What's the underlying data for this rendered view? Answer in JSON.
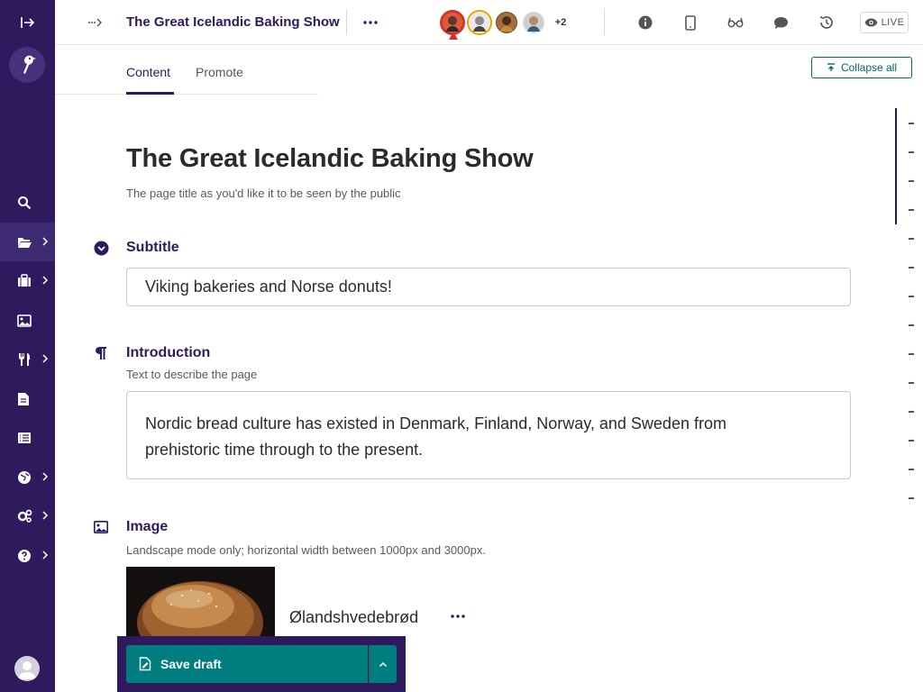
{
  "header": {
    "page_title": "The Great Icelandic Baking Show",
    "avatars_overflow": "+2",
    "live_label": "LIVE"
  },
  "tabs": [
    {
      "label": "Content",
      "active": true
    },
    {
      "label": "Promote",
      "active": false
    }
  ],
  "collapse_label": "Collapse all",
  "sidebar": {
    "items": [
      {
        "icon": "search-icon",
        "has_submenu": false
      },
      {
        "icon": "folder-open-icon",
        "has_submenu": true,
        "active": true
      },
      {
        "icon": "suitcase-icon",
        "has_submenu": true
      },
      {
        "icon": "image-icon",
        "has_submenu": false
      },
      {
        "icon": "utensils-icon",
        "has_submenu": true
      },
      {
        "icon": "document-icon",
        "has_submenu": false
      },
      {
        "icon": "list-icon",
        "has_submenu": false
      },
      {
        "icon": "globe-icon",
        "has_submenu": true
      },
      {
        "icon": "cogs-icon",
        "has_submenu": true
      },
      {
        "icon": "help-icon",
        "has_submenu": true
      }
    ]
  },
  "content": {
    "title": "The Great Icelandic Baking Show",
    "title_help": "The page title as you'd like it to be seen by the public",
    "subtitle": {
      "label": "Subtitle",
      "value": "Viking bakeries and Norse donuts!"
    },
    "introduction": {
      "label": "Introduction",
      "help": "Text to describe the page",
      "value": "Nordic bread culture has existed in Denmark, Finland, Norway, and Sweden from prehistoric time through to the present."
    },
    "image": {
      "label": "Image",
      "help": "Landscape mode only; horizontal width between 1000px and 3000px.",
      "filename": "Ølandshvedebrød"
    }
  },
  "save": {
    "label": "Save draft"
  },
  "colors": {
    "sidebar": "#2e1a5c",
    "accent": "#007d7e",
    "brand_text": "#2e1a5c"
  }
}
